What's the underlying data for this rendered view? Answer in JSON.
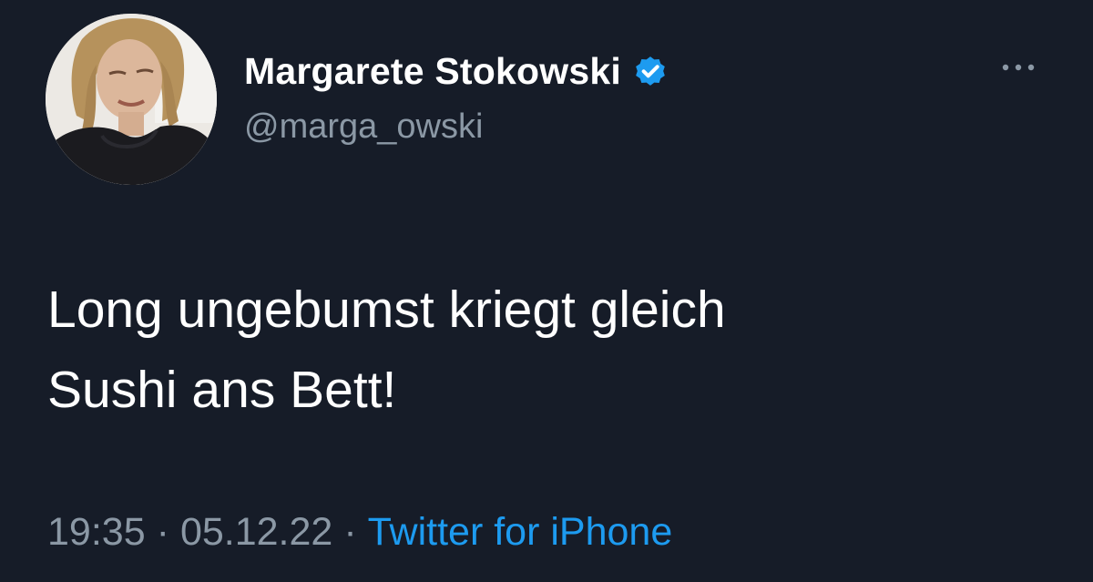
{
  "user": {
    "display_name": "Margarete Stokowski",
    "handle": "@marga_owski",
    "verified": true,
    "avatar_icon": "profile-photo"
  },
  "more_icon": "more-horizontal-icon",
  "tweet": {
    "lines": [
      "Long ungebumst kriegt gleich",
      "Sushi ans Bett!"
    ]
  },
  "meta": {
    "time": "19:35",
    "separator": "·",
    "date": "05.12.22",
    "source": "Twitter for iPhone"
  },
  "colors": {
    "background": "#161c28",
    "text": "#ffffff",
    "secondary": "#8b98a5",
    "accent": "#1d9bf0"
  }
}
